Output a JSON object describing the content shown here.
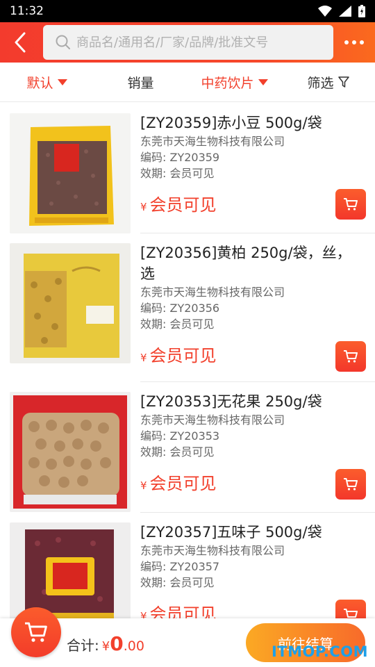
{
  "status_bar": {
    "time": "11:32"
  },
  "search": {
    "placeholder": "商品名/通用名/厂家/品牌/批准文号"
  },
  "filters": [
    {
      "label": "默认",
      "active": true,
      "has_arrow": true
    },
    {
      "label": "销量",
      "active": false,
      "has_arrow": false
    },
    {
      "label": "中药饮片",
      "active": true,
      "has_arrow": true
    },
    {
      "label": "筛选",
      "active": false,
      "has_arrow": false
    }
  ],
  "products": [
    {
      "name": "[ZY20359]赤小豆 500g/袋",
      "manufacturer": "东莞市天海生物科技有限公司",
      "code": "编码: ZY20359",
      "expiry": "效期: 会员可见",
      "currency": "¥",
      "price": "会员可见"
    },
    {
      "name": "[ZY20356]黄柏 250g/袋，丝，选",
      "manufacturer": "东莞市天海生物科技有限公司",
      "code": "编码: ZY20356",
      "expiry": "效期: 会员可见",
      "currency": "¥",
      "price": "会员可见"
    },
    {
      "name": "[ZY20353]无花果 250g/袋",
      "manufacturer": "东莞市天海生物科技有限公司",
      "code": "编码: ZY20353",
      "expiry": "效期: 会员可见",
      "currency": "¥",
      "price": "会员可见"
    },
    {
      "name": "[ZY20357]五味子 500g/袋",
      "manufacturer": "东莞市天海生物科技有限公司",
      "code": "编码: ZY20357",
      "expiry": "效期: 会员可见",
      "currency": "¥",
      "price": "会员可见"
    }
  ],
  "bottom": {
    "total_label": "合计:",
    "currency": "¥",
    "amount_int": "0",
    "amount_dec": ".00",
    "checkout_label": "前往结算"
  },
  "watermark": "ITMOP.COM",
  "colors": {
    "accent": "#f2402c",
    "header_start": "#f33b2d",
    "header_end": "#fb6a1e",
    "checkout_start": "#fba924",
    "checkout_end": "#f86a2a",
    "watermark": "#1ea0e8"
  }
}
